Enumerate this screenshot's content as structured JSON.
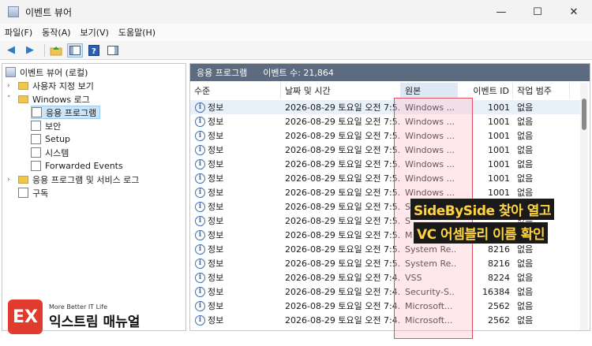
{
  "window": {
    "title": "이벤트 뷰어",
    "min": "—",
    "max": "☐",
    "close": "✕"
  },
  "menu": [
    "파일(F)",
    "동작(A)",
    "보기(V)",
    "도움말(H)"
  ],
  "tree": [
    {
      "label": "이벤트 뷰어 (로컬)"
    },
    {
      "label": "사용자 지정 보기"
    },
    {
      "label": "Windows 로그"
    },
    {
      "label": "응용 프로그램"
    },
    {
      "label": "보안"
    },
    {
      "label": "Setup"
    },
    {
      "label": "시스템"
    },
    {
      "label": "Forwarded Events"
    },
    {
      "label": "응용 프로그램 및 서비스 로그"
    },
    {
      "label": "구독"
    }
  ],
  "panel": {
    "title": "응용 프로그램",
    "count": "이벤트 수: 21,864"
  },
  "columns": [
    "수준",
    "날짜 및 시간",
    "원본",
    "이벤트 ID",
    "작업 범주"
  ],
  "events": [
    {
      "level": "정보",
      "datetime": "2026-08-29 토요일 오전 7:5...",
      "source": "Windows ...",
      "id": "1001",
      "category": "없음"
    },
    {
      "level": "정보",
      "datetime": "2026-08-29 토요일 오전 7:5...",
      "source": "Windows ...",
      "id": "1001",
      "category": "없음"
    },
    {
      "level": "정보",
      "datetime": "2026-08-29 토요일 오전 7:5...",
      "source": "Windows ...",
      "id": "1001",
      "category": "없음"
    },
    {
      "level": "정보",
      "datetime": "2026-08-29 토요일 오전 7:5...",
      "source": "Windows ...",
      "id": "1001",
      "category": "없음"
    },
    {
      "level": "정보",
      "datetime": "2026-08-29 토요일 오전 7:5...",
      "source": "Windows ...",
      "id": "1001",
      "category": "없음"
    },
    {
      "level": "정보",
      "datetime": "2026-08-29 토요일 오전 7:5...",
      "source": "Windows ...",
      "id": "1001",
      "category": "없음"
    },
    {
      "level": "정보",
      "datetime": "2026-08-29 토요일 오전 7:5...",
      "source": "Windows ...",
      "id": "1001",
      "category": "없음"
    },
    {
      "level": "정보",
      "datetime": "2026-08-29 토요일 오전 7:5...",
      "source": "S",
      "id": "",
      "category": "없음"
    },
    {
      "level": "정보",
      "datetime": "2026-08-29 토요일 오전 7:5...",
      "source": "S",
      "id": "",
      "category": "없음"
    },
    {
      "level": "정보",
      "datetime": "2026-08-29 토요일 오전 7:5...",
      "source": "M",
      "id": "",
      "category": "없음"
    },
    {
      "level": "정보",
      "datetime": "2026-08-29 토요일 오전 7:5...",
      "source": "System Re...",
      "id": "8216",
      "category": "없음"
    },
    {
      "level": "정보",
      "datetime": "2026-08-29 토요일 오전 7:5...",
      "source": "System Re...",
      "id": "8216",
      "category": "없음"
    },
    {
      "level": "정보",
      "datetime": "2026-08-29 토요일 오전 7:4...",
      "source": "VSS",
      "id": "8224",
      "category": "없음"
    },
    {
      "level": "정보",
      "datetime": "2026-08-29 토요일 오전 7:4...",
      "source": "Security-S...",
      "id": "16384",
      "category": "없음"
    },
    {
      "level": "정보",
      "datetime": "2026-08-29 토요일 오전 7:4...",
      "source": "Microsoft...",
      "id": "2562",
      "category": "없음"
    },
    {
      "level": "정보",
      "datetime": "2026-08-29 토요일 오전 7:4...",
      "source": "Microsoft...",
      "id": "2562",
      "category": "없음"
    }
  ],
  "annotation": {
    "line1": "SideBySide 찾아 열고",
    "line2": "VC 어셈블리 이름 확인"
  },
  "logo": {
    "mark": "EX",
    "tagline": "More Better IT Life",
    "name": "익스트림 매뉴얼"
  },
  "colors": {
    "highlight": "#e84a5f",
    "annotation_text": "#ffd23f",
    "panel_header": "#5c6b7f"
  }
}
